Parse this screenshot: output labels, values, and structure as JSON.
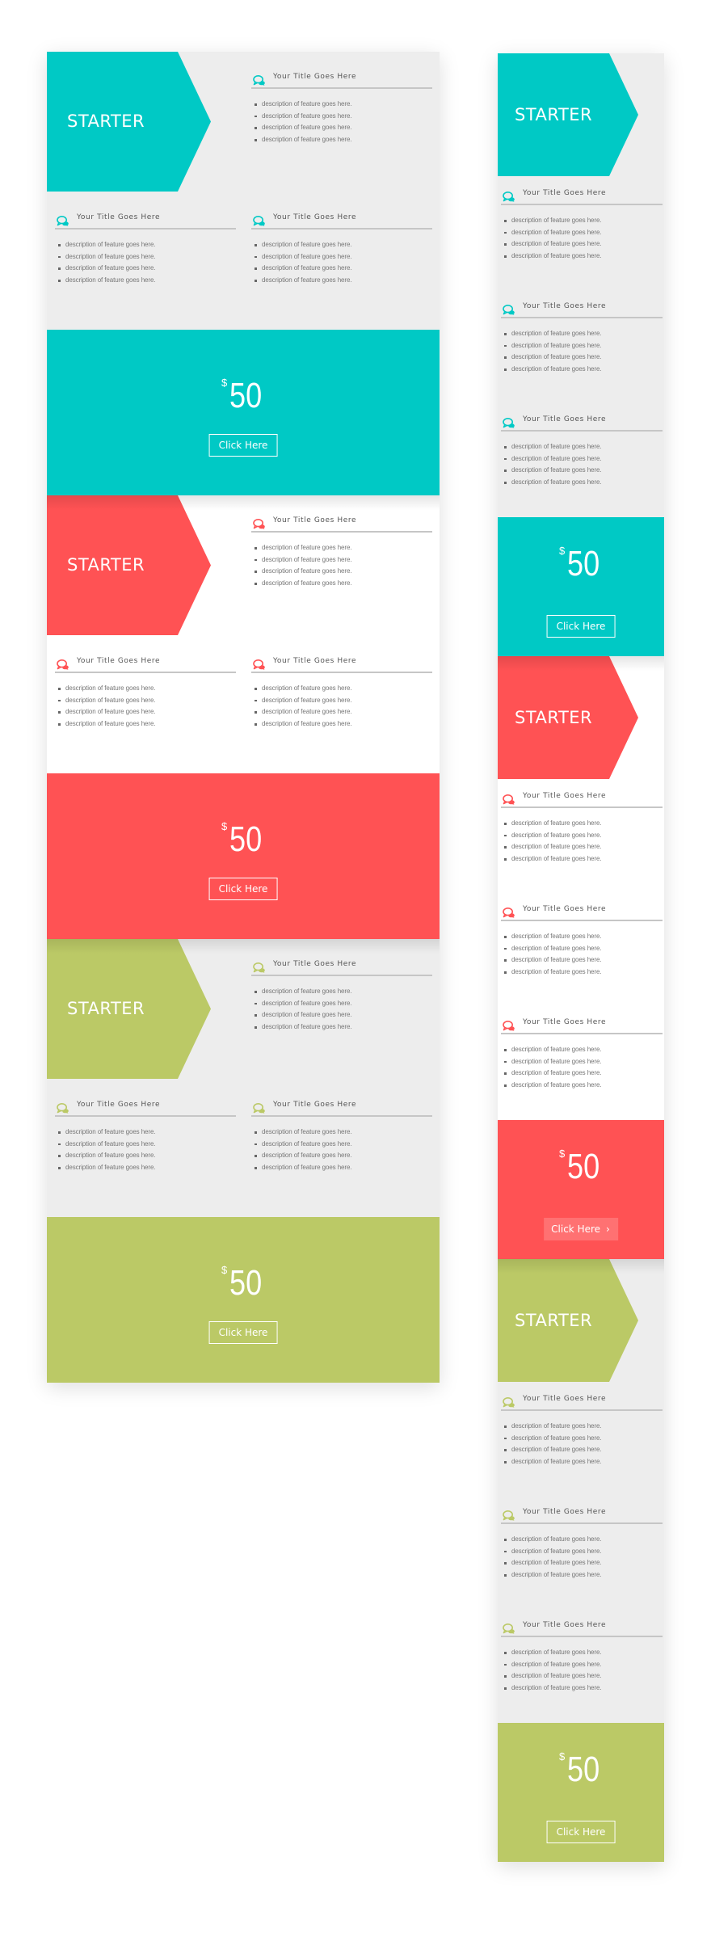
{
  "colors": {
    "cyan": "#00c9c5",
    "red": "#ff5254",
    "green": "#bbc966",
    "card_grey": "#ededed",
    "card_white": "#ffffff",
    "divider": "#c6c6c6",
    "title_text": "#555555",
    "body_text": "#777777"
  },
  "layouts": [
    {
      "id": "col-wide",
      "name": "pricing-table-desktop",
      "cards": [
        {
          "accent": "cyan",
          "background": "grey",
          "plan": "STARTER",
          "features": [
            {
              "title": "Your Title Goes Here",
              "items": [
                "description of feature goes here.",
                "description of feature goes here.",
                "description of feature goes here.",
                "description of feature goes here."
              ]
            },
            {
              "title": "Your Title Goes Here",
              "items": [
                "description of feature goes here.",
                "description of feature goes here.",
                "description of feature goes here.",
                "description of feature goes here."
              ]
            },
            {
              "title": "Your Title Goes Here",
              "items": [
                "description of feature goes here.",
                "description of feature goes here.",
                "description of feature goes here.",
                "description of feature goes here."
              ]
            }
          ],
          "currency": "$",
          "price": "50",
          "button": {
            "label": "Click Here",
            "state": "default"
          }
        },
        {
          "accent": "red",
          "background": "white",
          "plan": "STARTER",
          "features": [
            {
              "title": "Your Title Goes Here",
              "items": [
                "description of feature goes here.",
                "description of feature goes here.",
                "description of feature goes here.",
                "description of feature goes here."
              ]
            },
            {
              "title": "Your Title Goes Here",
              "items": [
                "description of feature goes here.",
                "description of feature goes here.",
                "description of feature goes here.",
                "description of feature goes here."
              ]
            },
            {
              "title": "Your Title Goes Here",
              "items": [
                "description of feature goes here.",
                "description of feature goes here.",
                "description of feature goes here.",
                "description of feature goes here."
              ]
            }
          ],
          "currency": "$",
          "price": "50",
          "button": {
            "label": "Click Here",
            "state": "default"
          }
        },
        {
          "accent": "green",
          "background": "grey",
          "plan": "STARTER",
          "features": [
            {
              "title": "Your Title Goes Here",
              "items": [
                "description of feature goes here.",
                "description of feature goes here.",
                "description of feature goes here.",
                "description of feature goes here."
              ]
            },
            {
              "title": "Your Title Goes Here",
              "items": [
                "description of feature goes here.",
                "description of feature goes here.",
                "description of feature goes here.",
                "description of feature goes here."
              ]
            },
            {
              "title": "Your Title Goes Here",
              "items": [
                "description of feature goes here.",
                "description of feature goes here.",
                "description of feature goes here.",
                "description of feature goes here."
              ]
            }
          ],
          "currency": "$",
          "price": "50",
          "button": {
            "label": "Click Here",
            "state": "default"
          }
        }
      ]
    },
    {
      "id": "col-narrow",
      "name": "pricing-table-mobile",
      "cards": [
        {
          "accent": "cyan",
          "background": "grey",
          "plan": "STARTER",
          "features": [
            {
              "title": "Your Title Goes Here",
              "items": [
                "description of feature goes here.",
                "description of feature goes here.",
                "description of feature goes here.",
                "description of feature goes here."
              ]
            },
            {
              "title": "Your Title Goes Here",
              "items": [
                "description of feature goes here.",
                "description of feature goes here.",
                "description of feature goes here.",
                "description of feature goes here."
              ]
            },
            {
              "title": "Your Title Goes Here",
              "items": [
                "description of feature goes here.",
                "description of feature goes here.",
                "description of feature goes here.",
                "description of feature goes here."
              ]
            }
          ],
          "currency": "$",
          "price": "50",
          "button": {
            "label": "Click Here",
            "state": "default"
          }
        },
        {
          "accent": "red",
          "background": "white",
          "plan": "STARTER",
          "features": [
            {
              "title": "Your Title Goes Here",
              "items": [
                "description of feature goes here.",
                "description of feature goes here.",
                "description of feature goes here.",
                "description of feature goes here."
              ]
            },
            {
              "title": "Your Title Goes Here",
              "items": [
                "description of feature goes here.",
                "description of feature goes here.",
                "description of feature goes here.",
                "description of feature goes here."
              ]
            },
            {
              "title": "Your Title Goes Here",
              "items": [
                "description of feature goes here.",
                "description of feature goes here.",
                "description of feature goes here.",
                "description of feature goes here."
              ]
            }
          ],
          "currency": "$",
          "price": "50",
          "button": {
            "label": "Click Here",
            "state": "hover",
            "icon": "chevron-right-icon"
          }
        },
        {
          "accent": "green",
          "background": "grey",
          "plan": "STARTER",
          "features": [
            {
              "title": "Your Title Goes Here",
              "items": [
                "description of feature goes here.",
                "description of feature goes here.",
                "description of feature goes here.",
                "description of feature goes here."
              ]
            },
            {
              "title": "Your Title Goes Here",
              "items": [
                "description of feature goes here.",
                "description of feature goes here.",
                "description of feature goes here.",
                "description of feature goes here."
              ]
            },
            {
              "title": "Your Title Goes Here",
              "items": [
                "description of feature goes here.",
                "description of feature goes here.",
                "description of feature goes here.",
                "description of feature goes here."
              ]
            }
          ],
          "currency": "$",
          "price": "50",
          "button": {
            "label": "Click Here",
            "state": "default"
          }
        }
      ]
    }
  ],
  "icons": {
    "feature": "chat-bubbles-icon",
    "button_hover": "chevron-right-icon"
  }
}
